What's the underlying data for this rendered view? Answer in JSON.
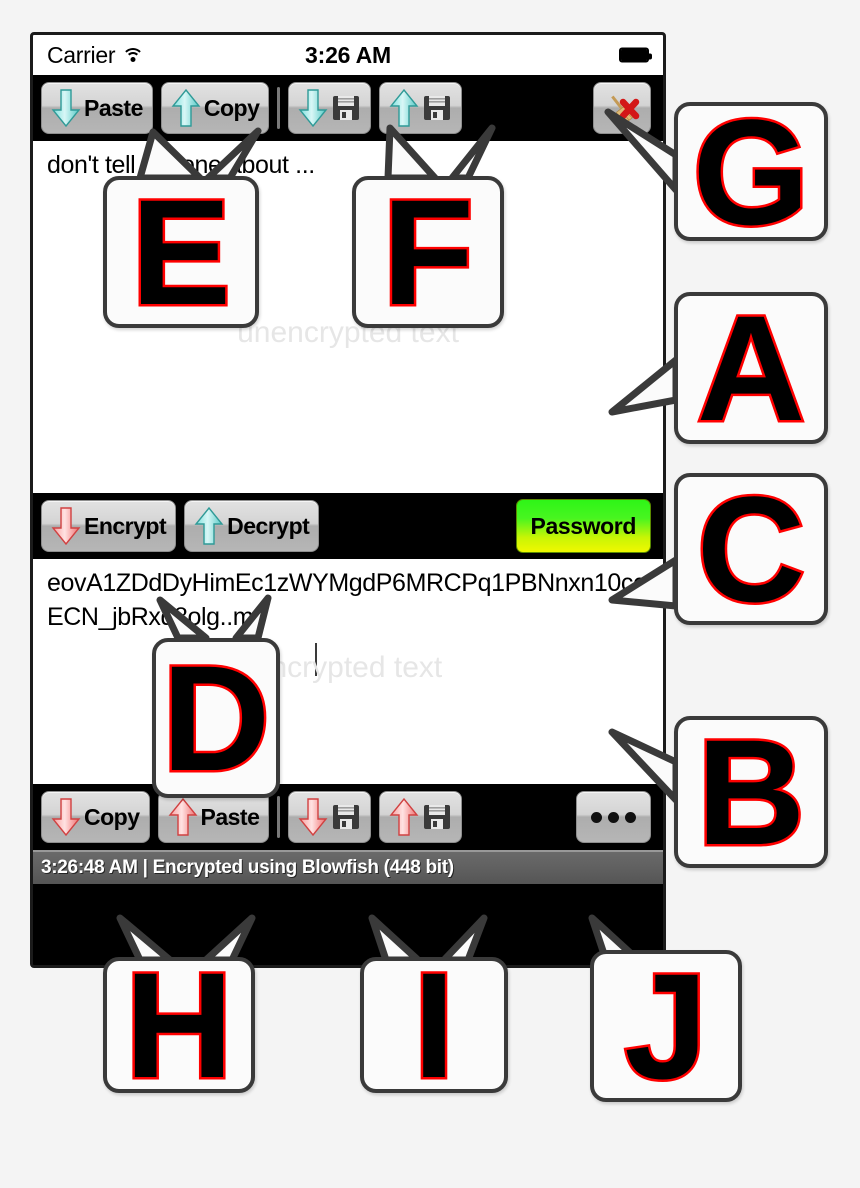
{
  "device": {
    "ios_status": {
      "carrier": "Carrier",
      "wifi_icon": "wifi-icon",
      "time": "3:26 AM",
      "battery_icon": "battery-full-icon"
    }
  },
  "top_toolbar": {
    "buttons": [
      {
        "id": "paste",
        "label": "Paste",
        "icon": "arrow-down-cyan-icon",
        "secondary_icon": null
      },
      {
        "id": "copy",
        "label": "Copy",
        "icon": "arrow-up-cyan-icon",
        "secondary_icon": null
      },
      {
        "id": "load",
        "label": "",
        "icon": "arrow-down-cyan-icon",
        "secondary_icon": "floppy-disk-icon"
      },
      {
        "id": "save",
        "label": "",
        "icon": "arrow-up-cyan-icon",
        "secondary_icon": "floppy-disk-icon"
      },
      {
        "id": "clear",
        "label": "",
        "icon": "broom-red-x-icon",
        "secondary_icon": null
      }
    ]
  },
  "plain_text_area": {
    "value": "don't tell anyone about ...",
    "placeholder": "unencrypted text"
  },
  "middle_toolbar": {
    "buttons": [
      {
        "id": "encrypt",
        "label": "Encrypt",
        "icon": "arrow-down-red-icon"
      },
      {
        "id": "decrypt",
        "label": "Decrypt",
        "icon": "arrow-up-cyan-icon"
      }
    ],
    "password_button": {
      "label": "Password",
      "color_start": "#2ef517",
      "color_end": "#f0f800"
    }
  },
  "cipher_text_area": {
    "value": "eovA1ZDdDyHimEc1zWYMgdP6MRCPq1PBNnxn10ccECN_jbRxd8olg..m",
    "placeholder": "encrypted text"
  },
  "bottom_toolbar": {
    "buttons": [
      {
        "id": "copy",
        "label": "Copy",
        "icon": "arrow-down-red-icon",
        "secondary_icon": null
      },
      {
        "id": "paste",
        "label": "Paste",
        "icon": "arrow-up-red-icon",
        "secondary_icon": null
      },
      {
        "id": "load",
        "label": "",
        "icon": "arrow-down-red-icon",
        "secondary_icon": "floppy-disk-icon"
      },
      {
        "id": "save",
        "label": "",
        "icon": "arrow-up-red-icon",
        "secondary_icon": "floppy-disk-icon"
      },
      {
        "id": "more",
        "label": "",
        "icon": "ellipsis-icon",
        "secondary_icon": null
      }
    ]
  },
  "app_status_bar": {
    "text": "3:26:48 AM | Encrypted using Blowfish (448 bit)"
  },
  "callouts": [
    {
      "id": "E",
      "letter": "E"
    },
    {
      "id": "F",
      "letter": "F"
    },
    {
      "id": "G",
      "letter": "G"
    },
    {
      "id": "A",
      "letter": "A"
    },
    {
      "id": "C",
      "letter": "C"
    },
    {
      "id": "D",
      "letter": "D"
    },
    {
      "id": "B",
      "letter": "B"
    },
    {
      "id": "H",
      "letter": "H"
    },
    {
      "id": "I",
      "letter": "I"
    },
    {
      "id": "J",
      "letter": "J"
    }
  ],
  "colors": {
    "callout_letter_fill": "#000000",
    "callout_letter_stroke": "#ff0000",
    "callout_border": "#3a3a3a",
    "toolbar_bg": "#000000",
    "status_bar_bg": "#606060",
    "cyan_arrow": "#7fe3e0",
    "red_arrow": "#ff9b9b"
  }
}
